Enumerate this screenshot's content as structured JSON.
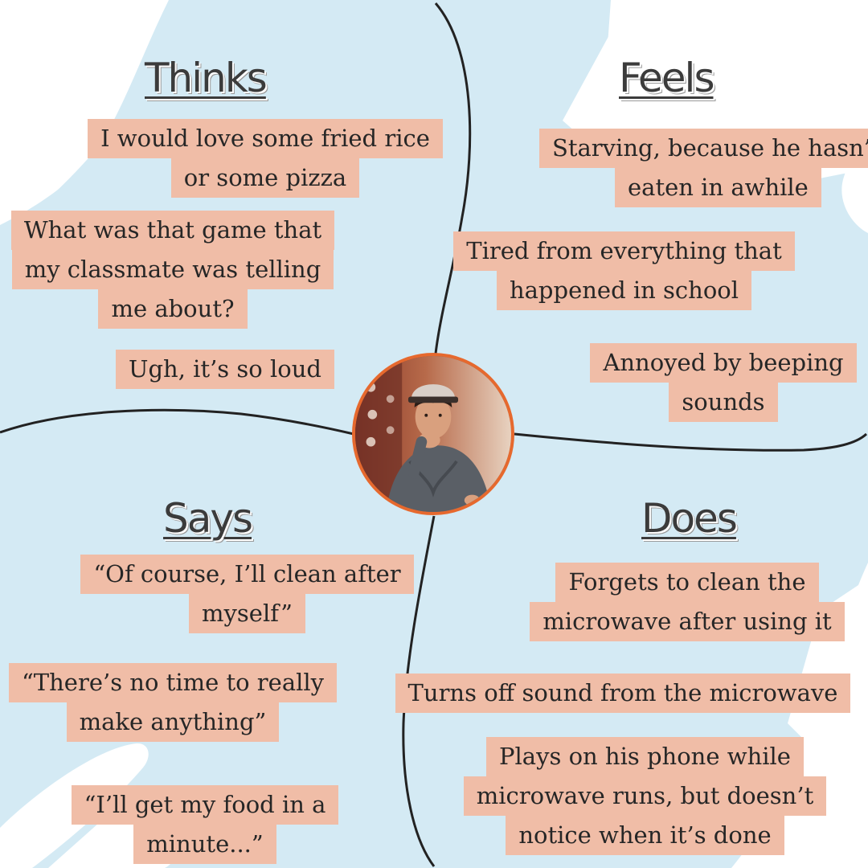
{
  "quadrants": {
    "thinks": {
      "title": "Thinks",
      "notes": [
        [
          "I would love some fried rice",
          "or some pizza"
        ],
        [
          "What was that game that",
          "my classmate was telling",
          "me about?"
        ],
        [
          "Ugh, it’s so loud"
        ]
      ]
    },
    "feels": {
      "title": "Feels",
      "notes": [
        [
          "Starving, because he hasn’t",
          "eaten in awhile"
        ],
        [
          "Tired from everything that",
          "happened in school"
        ],
        [
          "Annoyed by beeping",
          "sounds"
        ]
      ]
    },
    "says": {
      "title": "Says",
      "notes": [
        [
          "“Of course, I’ll clean after",
          "myself”"
        ],
        [
          "“There’s no time to really",
          "make anything”"
        ],
        [
          "“I’ll get my food in a",
          "minute...”"
        ]
      ]
    },
    "does": {
      "title": "Does",
      "notes": [
        [
          "Forgets to clean the",
          "microwave after using it"
        ],
        [
          "Turns off sound from the microwave"
        ],
        [
          "Plays on his phone while",
          "microwave runs, but doesn’t",
          "notice when it’s done"
        ]
      ]
    }
  },
  "colors": {
    "background_blob": "#d4eaf4",
    "sticky_note": "#f0bda7",
    "avatar_border": "#e6692e",
    "divider": "#222222"
  }
}
